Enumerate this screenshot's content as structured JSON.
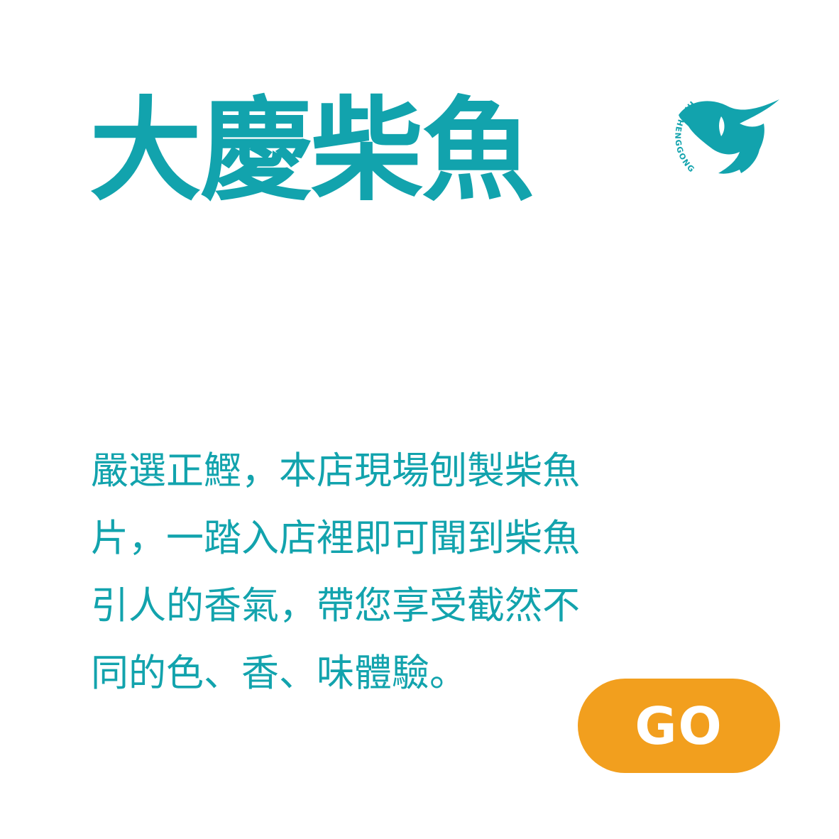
{
  "title": "大慶柴魚",
  "logo": {
    "icon": "bonito-fish-logo-icon",
    "wordmark": "HI CHENGGONG"
  },
  "description": "嚴選正鰹，本店現場刨製柴魚\n片，一踏入店裡即可聞到柴魚\n引人的香氣，帶您享受截然不\n同的色、香、味體驗。",
  "button": {
    "label": "GO"
  },
  "colors": {
    "brand": "#12a3ad",
    "button": "#f29f1e",
    "background": "#ffffff"
  }
}
